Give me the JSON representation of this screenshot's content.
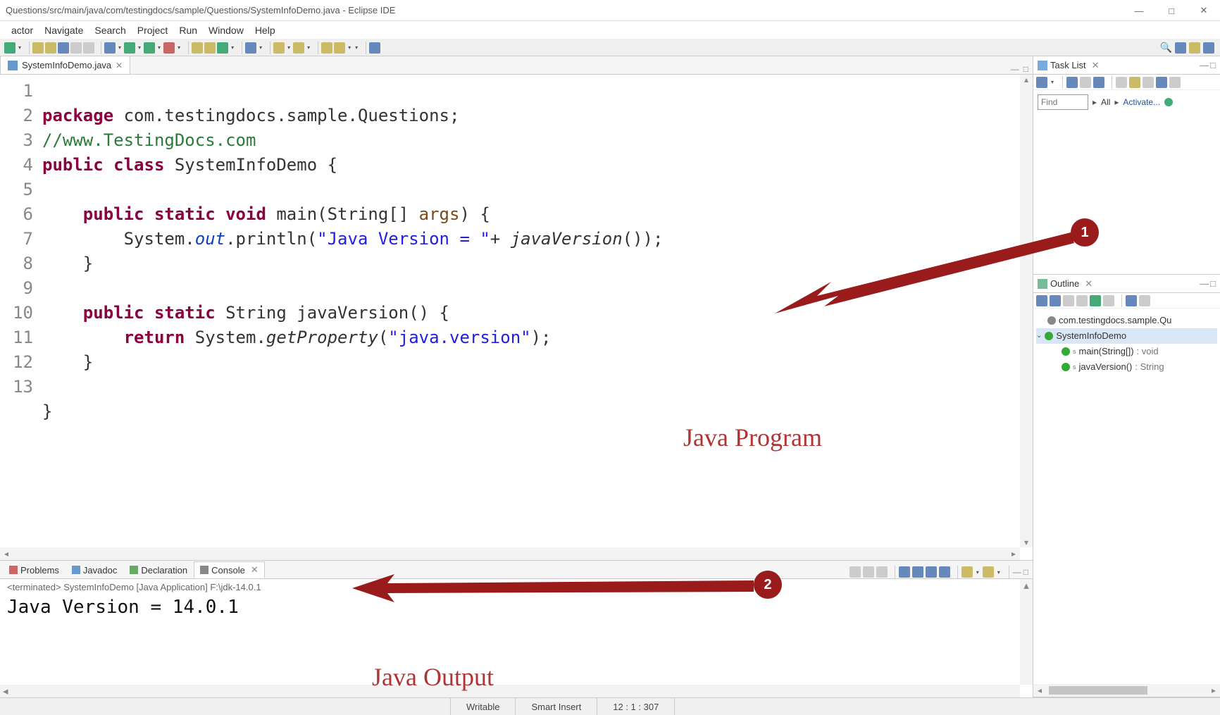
{
  "window": {
    "title": "Questions/src/main/java/com/testingdocs/sample/Questions/SystemInfoDemo.java - Eclipse IDE"
  },
  "menu": {
    "items": [
      "actor",
      "Navigate",
      "Search",
      "Project",
      "Run",
      "Window",
      "Help"
    ]
  },
  "editor": {
    "tab_file_name": "SystemInfoDemo.java",
    "code_lines": 13,
    "code": {
      "l1_pkg": "package",
      "l1_rest": " com.testingdocs.sample.Questions;",
      "l2": "//www.TestingDocs.com",
      "l3_a": "public",
      "l3_b": "class",
      "l3_c": " SystemInfoDemo {",
      "l4": "",
      "l5_a": "public",
      "l5_b": "static",
      "l5_c": "void",
      "l5_d": " main(String[] ",
      "l5_e": "args",
      "l5_f": ") {",
      "l6_a": "        System.",
      "l6_b": "out",
      "l6_c": ".println(",
      "l6_d": "\"Java Version = \"",
      "l6_e": "+ ",
      "l6_f": "javaVersion",
      "l6_g": "());",
      "l7": "    }",
      "l8": "",
      "l9_a": "public",
      "l9_b": "static",
      "l9_c": " String javaVersion() {",
      "l10_a": "return",
      "l10_b": " System.",
      "l10_c": "getProperty",
      "l10_d": "(",
      "l10_e": "\"java.version\"",
      "l10_f": ");",
      "l11": "    }",
      "l12": "",
      "l13": "}"
    }
  },
  "tasklist": {
    "title": "Task List",
    "find_placeholder": "Find",
    "filter_all": "All",
    "filter_activate": "Activate..."
  },
  "outline": {
    "title": "Outline",
    "package": "com.testingdocs.sample.Qu",
    "class": "SystemInfoDemo",
    "m1": "main(String[])",
    "m1t": "void",
    "m2": "javaVersion()",
    "m2t": "String"
  },
  "console": {
    "tabs": [
      "Problems",
      "Javadoc",
      "Declaration",
      "Console"
    ],
    "term_line": "<terminated> SystemInfoDemo [Java Application] F:\\jdk-14.0.1",
    "output": "Java Version = 14.0.1"
  },
  "status": {
    "writable": "Writable",
    "insert": "Smart Insert",
    "pos": "12 : 1 : 307"
  },
  "annotations": {
    "callout1": "1",
    "callout2": "2",
    "label1": "Java Program",
    "label2": "Java Output"
  }
}
